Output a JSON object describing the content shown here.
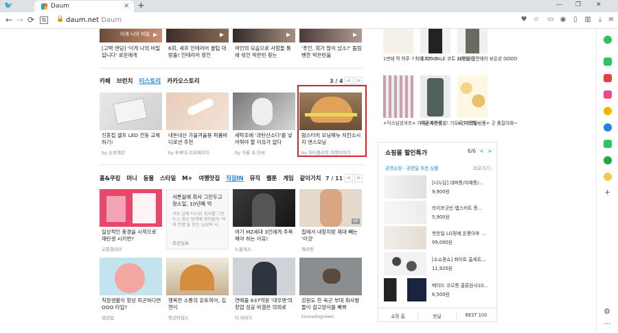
{
  "browser": {
    "tab_title": "Daum",
    "tab_close": "×",
    "new_tab": "+",
    "url_host": "daum.net",
    "url_suffix": "Daum",
    "lock": "🔒",
    "back": "←",
    "forward": "→",
    "reload": "⟳",
    "n_badge": "N",
    "minimize": "—",
    "restore": "❐",
    "close": "✕"
  },
  "top_row": [
    {
      "caption": "[고백 엔딩] '이게 나의 비밀입니다' 로운에게",
      "source": ""
    },
    {
      "caption": "6회, 셰프 인테리어 꿀팁 대방출! 인테리어 장인",
      "source": ""
    },
    {
      "caption": "여인의 모습으로 사람들 통에 섞인 박은빈 찾는",
      "source": ""
    },
    {
      "caption": "'푸인, 회가 많이 났소?' 돌림 벤한 박은빈을",
      "source": ""
    }
  ],
  "top_thumb_text": "이게 나의 비밀",
  "stories": {
    "tabs": [
      {
        "label": "카페"
      },
      {
        "label": "브런치"
      },
      {
        "label": "티스토리"
      },
      {
        "label": "카카오스토리"
      }
    ],
    "pager": "3 / 4",
    "prev": "<",
    "next": ">",
    "cards": [
      {
        "caption": "신혼집 셀프 LED 전등 교체하기!",
        "source": "by 신성계란"
      },
      {
        "caption": "내돈내산 가을겨울용 퍼퓸바디로션 추천",
        "source": "by 두루네 리뷰페이지"
      },
      {
        "caption": "세탁조에 '과탄산소다'를 넣어줘야 할 이유가 없다",
        "source": "by 가을 속 단비"
      },
      {
        "caption": "맘스터치 모닝메뉴 치킨소시지 앤스모닝",
        "source": "by 히티플리의 여행이야기"
      }
    ]
  },
  "media": {
    "tabs": [
      {
        "label": "홈&쿠킹"
      },
      {
        "label": "머니"
      },
      {
        "label": "동물"
      },
      {
        "label": "스타일"
      },
      {
        "label": "M+"
      },
      {
        "label": "여행맛집"
      },
      {
        "label": "직장IN"
      },
      {
        "label": "뮤직"
      },
      {
        "label": "웹툰"
      },
      {
        "label": "게임"
      },
      {
        "label": "같이가치"
      }
    ],
    "pager": "7 / 11",
    "prev": "<",
    "next": ">",
    "text_card": {
      "title": "서른살에 회사 그만두고 청소일, 10년째 억",
      "body": "서른 살에 다니던 회사를 그만두고 청소 업계에 뛰어들어 '억대 연봉'을 받는 남성의 사",
      "source": "조선일보"
    },
    "ad_badge": "AD",
    "row1": [
      {
        "caption": "일상적인 풍경을 시적으로 재탄생 시키면?",
        "source": "오픈갤러리"
      },
      {
        "caption": "여기 MZ세대 3인에게 주목해야 하는 이유!",
        "source": "노블레스"
      },
      {
        "caption": "집에서 내장지방 제대 빼는 '이것'",
        "source": "헤라핏"
      }
    ],
    "row2": [
      {
        "caption": "직장생활이 항상 피곤하다면 OOO 타입?",
        "source": "덴션업"
      },
      {
        "caption": "행복한 소통의 유토피아, 김현이",
        "source": "청년타임스"
      },
      {
        "caption": "연매출 637억원 '대우맨'의 창업 성공 비결은 의외로",
        "source": "더 비비드"
      },
      {
        "caption": "강원도 한 육군 부대 취사병들이 길고양이를 빠쁘",
        "source": "koreadognews"
      }
    ]
  },
  "shopping_grid": [
    {
      "caption": "1번에 딱 하루 ↑최대 73%↑"
    },
    {
      "caption": "히지스 SALE 코트 10만원대"
    },
    {
      "caption": "사무실 간편웨어 보온성 GOOD"
    },
    {
      "caption": "+닥스남성셔츠+ 가격진짜인킹"
    },
    {
      "caption": "지금 주문폭발! 기모로 따뜻해~"
    },
    {
      "caption": "+인기폭발상품+ 굿 품질이래~"
    }
  ],
  "deals": {
    "title": "쇼핑몰 할인특가",
    "pager": "6/6",
    "subtitle": "공영쇼핑 - 공영밀 추천 상품",
    "more": "바로가기 ›",
    "items": [
      {
        "name": "[나누담] 대파통/야채통/...",
        "price": "9,900원"
      },
      {
        "name": "라이프굿빈 렙스커트 통...",
        "price": "5,900원"
      },
      {
        "name": "핫한일 LG정예 온풍아후 ...",
        "price": "99,000원"
      },
      {
        "name": "[소쇼몽쇼] 화이트 홈세트...",
        "price": "11,920원"
      },
      {
        "name": "메이드 코오롱 클론원사10...",
        "price": "6,500원"
      }
    ],
    "footer_tabs": [
      {
        "label": "쇼핑 홈"
      },
      {
        "label": "핫딜"
      },
      {
        "label": "BEST 100"
      }
    ]
  },
  "sidepanel": {
    "add": "+",
    "settings": "⚙",
    "more": "···"
  },
  "colors": {
    "accent": "#1e84e0",
    "highlight": "#d7232f"
  }
}
